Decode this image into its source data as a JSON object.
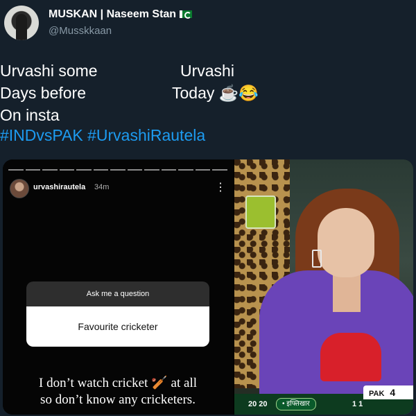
{
  "tweet": {
    "author_name": "MUSKAN | Naseem Stan",
    "author_handle": "@Musskkaan",
    "left_lines": [
      "Urvashi some",
      "Days before",
      "On insta"
    ],
    "right_lines": [
      "Urvashi",
      "Today ☕😂"
    ],
    "hashtags": "#INDvsPAK #UrvashiRautela",
    "colors": {
      "background": "#15202b",
      "link": "#1d9bf0",
      "muted": "#8899a6"
    }
  },
  "story": {
    "username": "urvashirautela",
    "time": "34m",
    "more_icon": "⋮",
    "question_prompt": "Ask me a question",
    "question_answer": "Favourite cricketer",
    "caption_line1": "I don’t watch cricket 🏏 at all",
    "caption_line2": "so don’t know any cricketers."
  },
  "scoreboard": {
    "overs": "20 20",
    "batter": "• इफ्तिखार",
    "batter_runs": "1 1",
    "team": "PAK",
    "team_score": "4"
  },
  "icons": [
    "verified-flag-icon",
    "more-vert-icon",
    "cricket-bat-icon"
  ]
}
